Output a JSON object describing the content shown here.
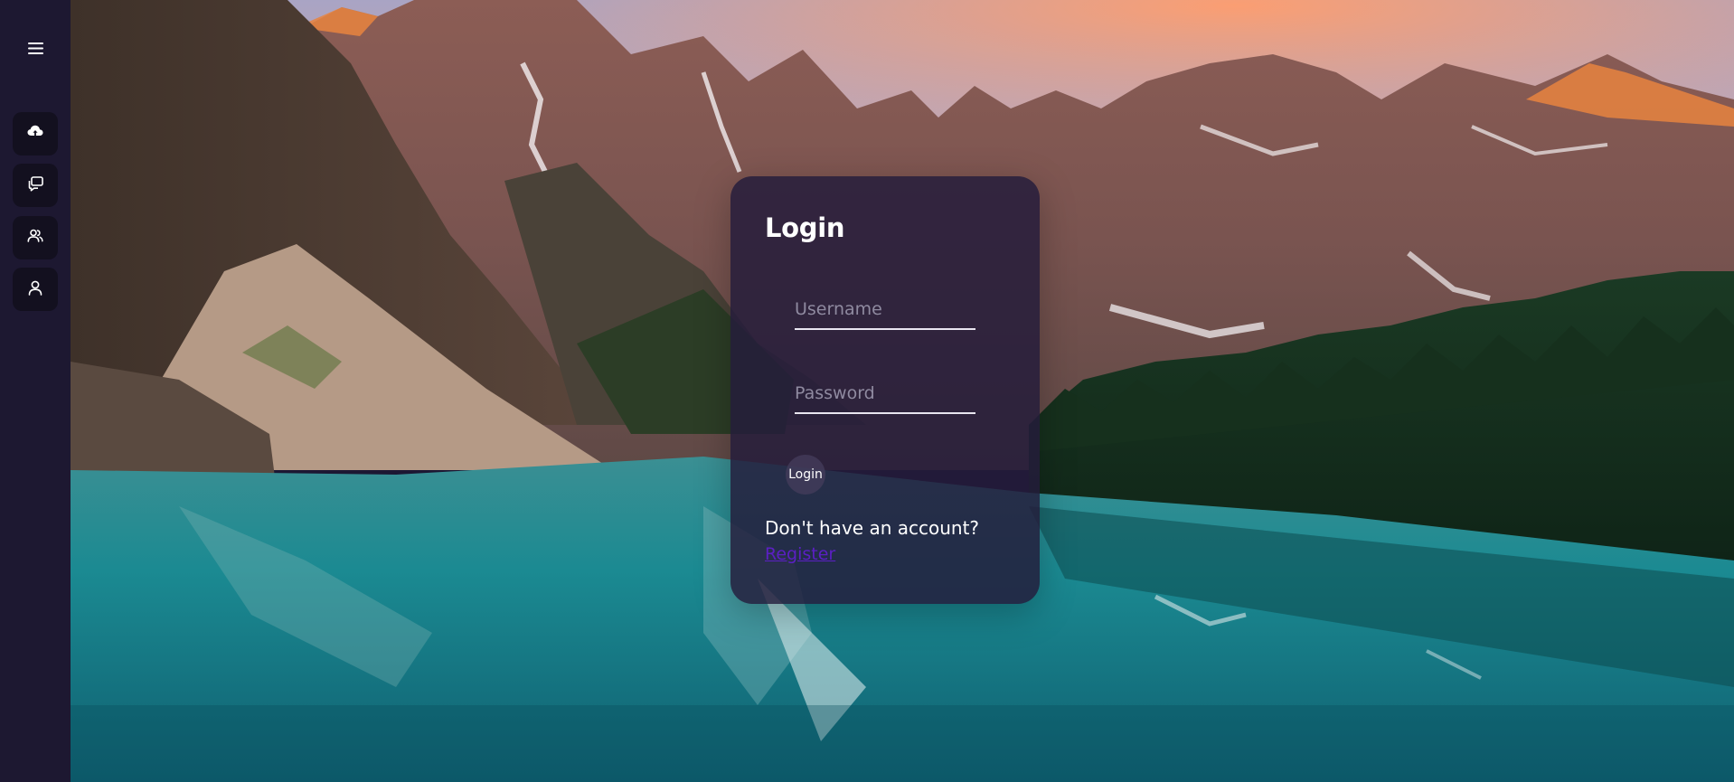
{
  "sidebar": {
    "menu_icon": "hamburger-menu-icon",
    "items": [
      {
        "icon": "cloud-upload-icon"
      },
      {
        "icon": "chat-bubbles-icon"
      },
      {
        "icon": "users-icon"
      },
      {
        "icon": "user-profile-icon"
      }
    ]
  },
  "login": {
    "title": "Login",
    "username_placeholder": "Username",
    "password_placeholder": "Password",
    "button_label": "Login",
    "no_account_text": "Don't have an account?",
    "register_label": "Register"
  },
  "colors": {
    "sidebar_bg": "#1d1831",
    "nav_button_bg": "#13101f",
    "card_bg": "#241c3a",
    "register_link": "#5b1fc4"
  }
}
